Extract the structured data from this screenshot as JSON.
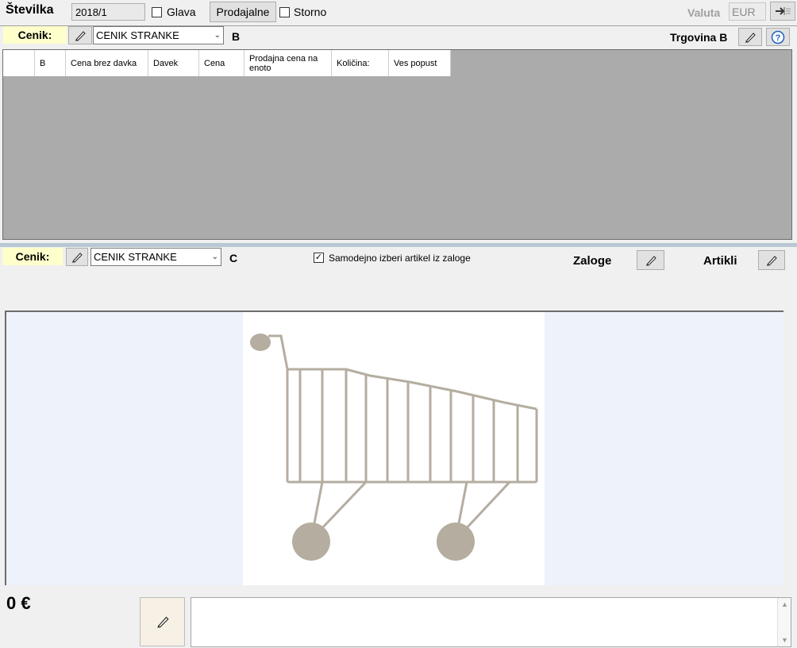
{
  "header": {
    "stevilka_label": "Številka",
    "stevilka_value": "2018/1",
    "glava_label": "Glava",
    "prodajalne_label": "Prodajalne",
    "storno_label": "Storno",
    "valuta_label": "Valuta",
    "valuta_value": "EUR"
  },
  "panel_b": {
    "cenik_label": "Cenik:",
    "cenik_value": "CENIK STRANKE",
    "letter": "B",
    "trgovina_label": "Trgovina B",
    "columns": [
      {
        "label": "B",
        "w": 39
      },
      {
        "label": "Cena brez davka",
        "w": 104
      },
      {
        "label": "Davek",
        "w": 64
      },
      {
        "label": "Cena",
        "w": 57
      },
      {
        "label": "Prodajna cena na enoto",
        "w": 110
      },
      {
        "label": "Količina:",
        "w": 72
      },
      {
        "label": "Ves popust",
        "w": 78
      }
    ]
  },
  "panel_c": {
    "cenik_label": "Cenik:",
    "cenik_value": "CENIK STRANKE",
    "letter": "C",
    "auto_select_label": "Samodejno izberi artikel iz zaloge",
    "auto_select_checked": true,
    "zaloge_label": "Zaloge",
    "artikli_label": "Artikli"
  },
  "footer": {
    "total": "0 €"
  },
  "colors": {
    "cenik_label_bg": "#ffffcc",
    "grid_bg": "#ababab",
    "cart_color": "#b4ada0"
  }
}
